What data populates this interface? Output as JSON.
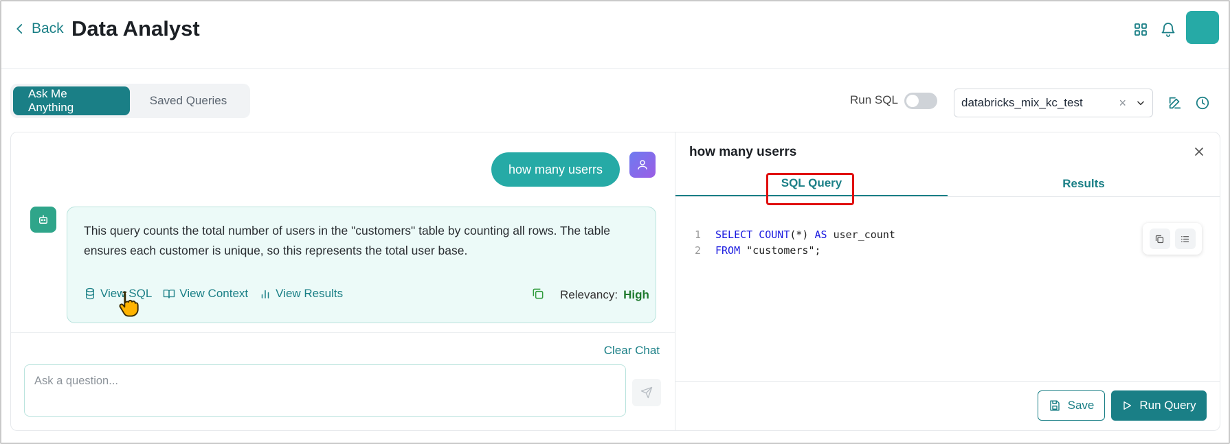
{
  "header": {
    "back_label": "Back",
    "title": "Data Analyst"
  },
  "toolbar": {
    "tabs": [
      {
        "label": "Ask Me Anything",
        "active": true
      },
      {
        "label": "Saved Queries",
        "active": false
      }
    ],
    "run_sql_label": "Run SQL",
    "run_sql_enabled": false,
    "database": {
      "selected": "databricks_mix_kc_test",
      "clear_glyph": "×"
    }
  },
  "chat": {
    "user_message": "how many userrs",
    "bot_message": "This query counts the total number of users in the \"customers\" table by counting all rows. The table ensures each customer is unique, so this represents the total user base.",
    "actions": {
      "view_sql": "View SQL",
      "view_context": "View Context",
      "view_results": "View Results"
    },
    "relevancy_label": "Relevancy:",
    "relevancy_value": "High",
    "clear_chat_label": "Clear Chat",
    "input_placeholder": "Ask a question..."
  },
  "sql_panel": {
    "title": "how many userrs",
    "tabs": [
      {
        "label": "SQL Query",
        "active": true
      },
      {
        "label": "Results",
        "active": false
      }
    ],
    "code": {
      "line1_num": "1",
      "line1_kw1": "SELECT COUNT",
      "line1_rest1": "(*) ",
      "line1_kw2": "AS",
      "line1_rest2": " user_count",
      "line2_num": "2",
      "line2_kw": "FROM",
      "line2_rest": " \"customers\";"
    },
    "save_label": "Save",
    "run_label": "Run Query"
  },
  "colors": {
    "primary": "#1a7f86",
    "user_bubble": "#26aaa6",
    "bot_card_bg": "#ecfaf8",
    "highlight": "#e01010",
    "relevancy_high": "#1f7a2e"
  }
}
